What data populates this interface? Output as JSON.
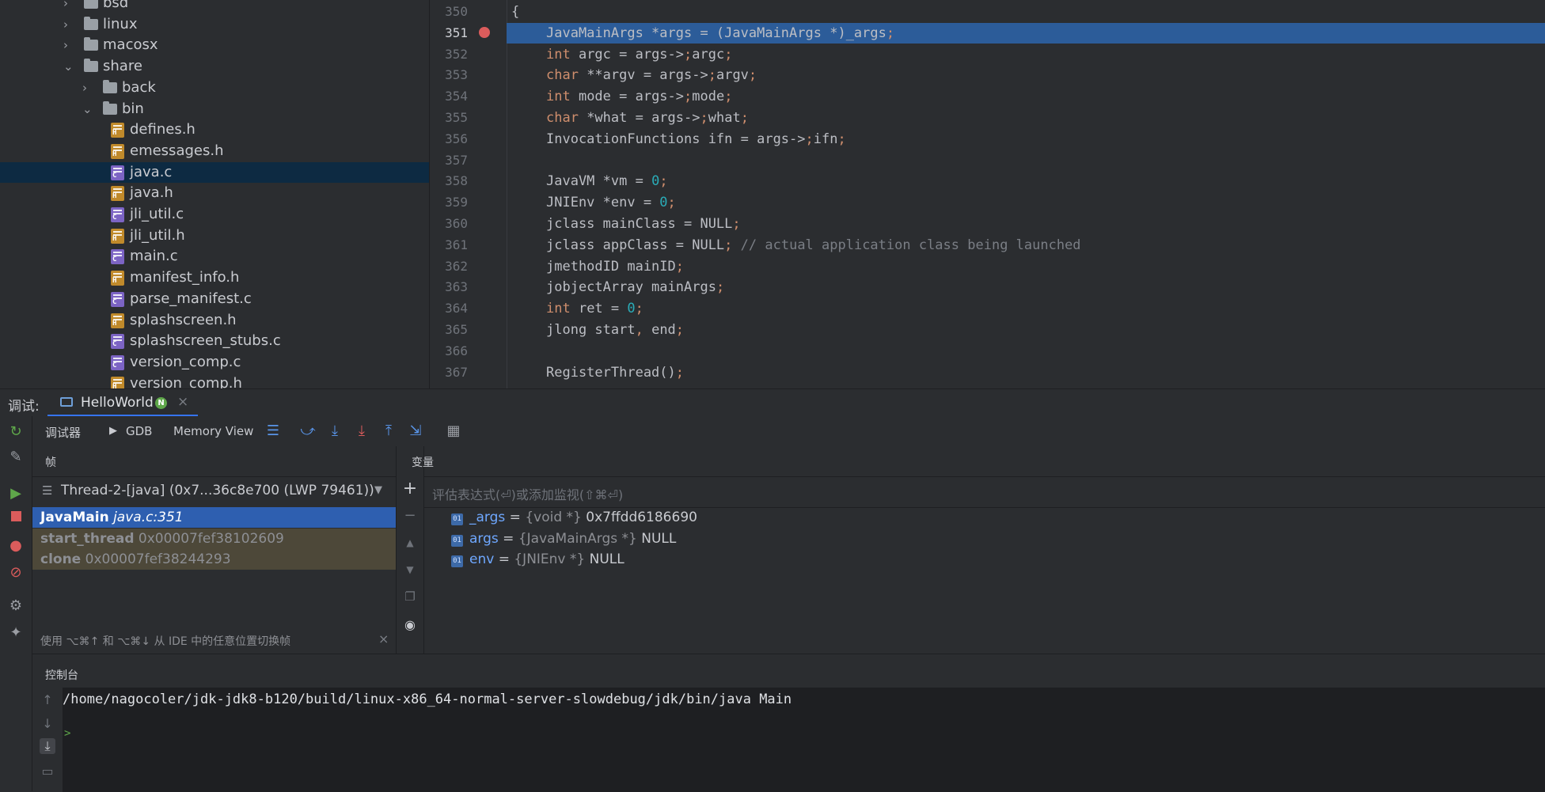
{
  "project_tree": {
    "items": [
      {
        "label": "bsd",
        "type": "folder",
        "expanded": false
      },
      {
        "label": "linux",
        "type": "folder",
        "expanded": false
      },
      {
        "label": "macosx",
        "type": "folder",
        "expanded": false
      },
      {
        "label": "share",
        "type": "folder",
        "expanded": true
      },
      {
        "label": "back",
        "type": "folder",
        "expanded": false
      },
      {
        "label": "bin",
        "type": "folder",
        "expanded": true
      },
      {
        "label": "defines.h",
        "type": "h"
      },
      {
        "label": "emessages.h",
        "type": "h"
      },
      {
        "label": "java.c",
        "type": "c",
        "selected": true
      },
      {
        "label": "java.h",
        "type": "h"
      },
      {
        "label": "jli_util.c",
        "type": "c"
      },
      {
        "label": "jli_util.h",
        "type": "h"
      },
      {
        "label": "main.c",
        "type": "c"
      },
      {
        "label": "manifest_info.h",
        "type": "h"
      },
      {
        "label": "parse_manifest.c",
        "type": "c"
      },
      {
        "label": "splashscreen.h",
        "type": "h"
      },
      {
        "label": "splashscreen_stubs.c",
        "type": "c"
      },
      {
        "label": "version_comp.c",
        "type": "c"
      },
      {
        "label": "version_comp.h",
        "type": "h"
      }
    ],
    "badge_h": "H",
    "badge_c": "C"
  },
  "editor": {
    "current_line": 351,
    "lines": [
      {
        "n": "350",
        "code": "{"
      },
      {
        "n": "351",
        "code": "JavaMainArgs *args = (JavaMainArgs *)_args;"
      },
      {
        "n": "352",
        "code": "int argc = args->argc;"
      },
      {
        "n": "353",
        "code": "char **argv = args->argv;"
      },
      {
        "n": "354",
        "code": "int mode = args->mode;"
      },
      {
        "n": "355",
        "code": "char *what = args->what;"
      },
      {
        "n": "356",
        "code": "InvocationFunctions ifn = args->ifn;"
      },
      {
        "n": "357",
        "code": ""
      },
      {
        "n": "358",
        "code": "JavaVM *vm = 0;"
      },
      {
        "n": "359",
        "code": "JNIEnv *env = 0;"
      },
      {
        "n": "360",
        "code": "jclass mainClass = NULL;"
      },
      {
        "n": "361",
        "code": "jclass appClass = NULL; // actual application class being launched"
      },
      {
        "n": "362",
        "code": "jmethodID mainID;"
      },
      {
        "n": "363",
        "code": "jobjectArray mainArgs;"
      },
      {
        "n": "364",
        "code": "int ret = 0;"
      },
      {
        "n": "365",
        "code": "jlong start, end;"
      },
      {
        "n": "366",
        "code": ""
      },
      {
        "n": "367",
        "code": "RegisterThread();"
      }
    ]
  },
  "debug": {
    "title": "调试:",
    "session_tab": "HelloWorld",
    "session_badge": "N",
    "close": "×",
    "tabs": {
      "debugger": "调试器",
      "gdb": "GDB",
      "memory": "Memory View"
    },
    "frames": {
      "header": "帧",
      "thread": "Thread-2-[java] (0x7...36c8e700 (LWP 79461))",
      "items": [
        {
          "name": "JavaMain",
          "loc": "java.c:351",
          "selected": true
        },
        {
          "name": "start_thread",
          "loc": "0x00007fef38102609"
        },
        {
          "name": "clone",
          "loc": "0x00007fef38244293"
        }
      ],
      "hint": "使用 ⌥⌘↑ 和 ⌥⌘↓ 从 IDE 中的任意位置切换帧",
      "hint_close": "×"
    },
    "variables": {
      "header": "变量",
      "eval_placeholder": "评估表达式(⏎)或添加监视(⇧⌘⏎)",
      "badge": "01",
      "items": [
        {
          "name": "_args",
          "eq": " = ",
          "type": "{void *}",
          "value": "0x7ffdd6186690"
        },
        {
          "name": "args",
          "eq": " = ",
          "type": "{JavaMainArgs *}",
          "value": "NULL"
        },
        {
          "name": "env",
          "eq": " = ",
          "type": "{JNIEnv *}",
          "value": "NULL"
        }
      ]
    },
    "console": {
      "header": "控制台",
      "command": "/home/nagocoler/jdk-jdk8-b120/build/linux-x86_64-normal-server-slowdebug/jdk/bin/java Main",
      "prompt": ">"
    }
  },
  "colors": {
    "accent": "#3574f0",
    "selection": "#2e5fb0",
    "breakpoint": "#db5c5c",
    "keyword": "#cf8e6d",
    "number": "#2aacb8"
  }
}
